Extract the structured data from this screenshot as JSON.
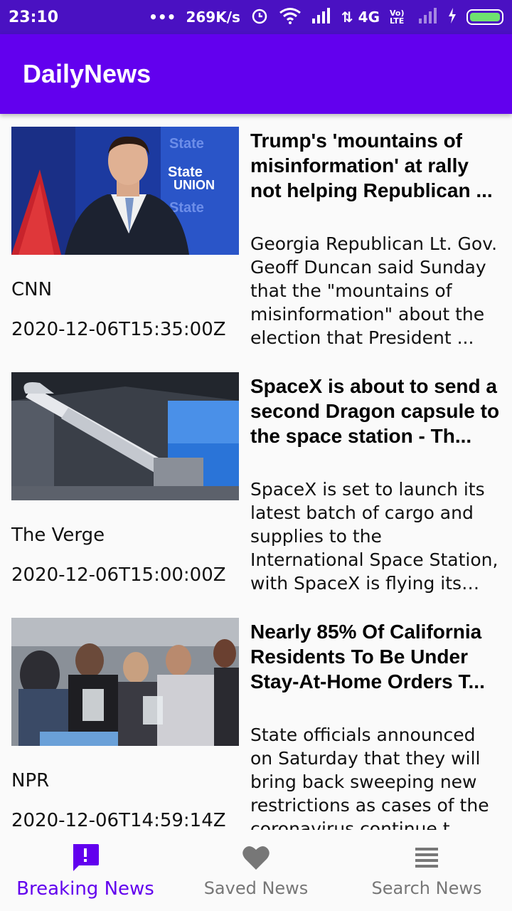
{
  "status_bar": {
    "time": "23:10",
    "dots": "•••",
    "net_speed": "269K/s",
    "network": "4G",
    "volte": "Vo) LTE"
  },
  "app_bar": {
    "title": "DailyNews"
  },
  "articles": [
    {
      "headline": "Trump's 'mountains of misinformation' at rally not helping Republican ...",
      "description": "Georgia Republican Lt. Gov. Geoff Duncan said Sunday that the \"mountains of misinformation\" about the election that President ...",
      "source": "CNN",
      "published": "2020-12-06T15:35:00Z"
    },
    {
      "headline": "SpaceX is about to send a second Dragon capsule to the space station - Th...",
      "description": "SpaceX is set to launch its latest batch of cargo and supplies to the International Space Station, with SpaceX is flying its newly upgrade...",
      "source": "The Verge",
      "published": "2020-12-06T15:00:00Z"
    },
    {
      "headline": "Nearly 85% Of California Residents To Be Under Stay-At-Home Orders T...",
      "description": "State officials announced on Saturday that they will bring back sweeping new restrictions as cases of the coronavirus continue t",
      "source": "NPR",
      "published": "2020-12-06T14:59:14Z"
    }
  ],
  "bottom_nav": {
    "items": [
      {
        "label": "Breaking News",
        "icon": "alert-message-icon",
        "active": true
      },
      {
        "label": "Saved News",
        "icon": "heart-icon",
        "active": false
      },
      {
        "label": "Search News",
        "icon": "list-icon",
        "active": false
      }
    ]
  },
  "colors": {
    "status_bar": "#4a11c2",
    "app_bar": "#6200ee",
    "accent": "#6200ee",
    "inactive": "#777777"
  }
}
